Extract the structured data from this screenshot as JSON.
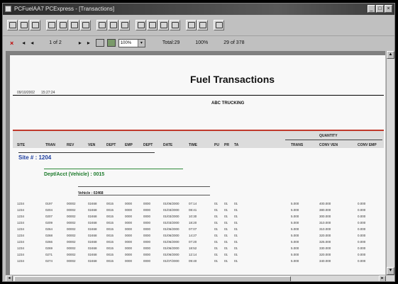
{
  "window": {
    "title": "PCFuelAA7 PCExpress - [Transactions]",
    "controls": [
      "_",
      "□",
      "×"
    ]
  },
  "toolbar": {
    "groups": [
      3,
      4,
      3,
      4,
      2,
      1
    ]
  },
  "viewer": {
    "close": "×",
    "first": "◂",
    "prev": "◂",
    "page_of": "1 of 2",
    "next": "▸",
    "last": "▸",
    "zoom": "100%",
    "total": "Total:29",
    "pct": "100%",
    "rec": "29 of 378"
  },
  "report": {
    "title": "Fuel Transactions",
    "date": "09/10/2002",
    "time": "15:27:24",
    "company": "ABC TRUCKING",
    "quantity_label": "QUANTITY",
    "columns": [
      "SITE",
      "TRAN",
      "REV",
      "VEN",
      "DEPT",
      "EMP",
      "DEPT",
      "DATE",
      "TIME",
      "PU",
      "PR",
      "TA",
      "TRANS",
      "CONV VEN",
      "CONV EMP"
    ],
    "site_label": "Site # : 1204",
    "dept_label": "Dept/Acct (Vehicle) : 0015",
    "vehicle_label": "Vehicle : 02468",
    "rows": [
      [
        "1234",
        "0197",
        "00002",
        "02468",
        "0015",
        "0000",
        "0000",
        "01/06/2000",
        "07:14",
        "01",
        "01",
        "01",
        "5.000",
        "400.000",
        "0.000"
      ],
      [
        "1234",
        "0204",
        "00002",
        "02468",
        "0015",
        "0000",
        "0000",
        "01/03/2000",
        "08:41",
        "01",
        "01",
        "01",
        "5.000",
        "380.000",
        "0.000"
      ],
      [
        "1234",
        "0207",
        "00002",
        "02468",
        "0015",
        "0000",
        "0000",
        "01/03/2000",
        "10:30",
        "01",
        "01",
        "01",
        "5.000",
        "300.000",
        "0.000"
      ],
      [
        "1234",
        "0209",
        "00002",
        "02468",
        "0015",
        "0000",
        "0000",
        "01/03/2000",
        "18:20",
        "01",
        "01",
        "01",
        "5.000",
        "310.000",
        "0.000"
      ],
      [
        "1234",
        "0264",
        "00002",
        "02468",
        "0015",
        "0000",
        "0000",
        "01/06/2000",
        "07:07",
        "01",
        "01",
        "01",
        "5.000",
        "310.000",
        "0.000"
      ],
      [
        "1234",
        "0268",
        "00002",
        "02468",
        "0015",
        "0000",
        "0000",
        "01/06/2000",
        "14:27",
        "01",
        "01",
        "01",
        "5.000",
        "320.000",
        "0.000"
      ],
      [
        "1234",
        "0266",
        "00002",
        "02468",
        "0015",
        "0000",
        "0000",
        "01/06/2000",
        "07:20",
        "01",
        "01",
        "01",
        "5.000",
        "325.000",
        "0.000"
      ],
      [
        "1234",
        "0269",
        "00002",
        "02468",
        "0015",
        "0000",
        "0000",
        "01/06/2000",
        "18:52",
        "01",
        "01",
        "01",
        "5.000",
        "330.000",
        "0.000"
      ],
      [
        "1234",
        "0271",
        "00002",
        "02468",
        "0015",
        "0000",
        "0000",
        "01/06/2000",
        "12:14",
        "01",
        "01",
        "01",
        "5.000",
        "320.000",
        "0.000"
      ],
      [
        "1234",
        "0274",
        "00002",
        "02468",
        "0015",
        "0000",
        "0000",
        "01/07/2000",
        "09:40",
        "01",
        "01",
        "01",
        "5.000",
        "340.000",
        "0.000"
      ]
    ]
  }
}
